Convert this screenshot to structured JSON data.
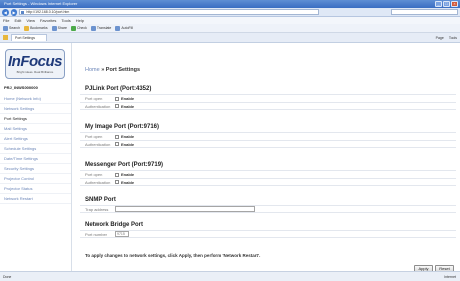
{
  "window": {
    "title": "Port Settings - Windows Internet Explorer"
  },
  "browser": {
    "url": "http://192.168.0.10/port.htm",
    "menu": [
      "File",
      "Edit",
      "View",
      "Favorites",
      "Tools",
      "Help"
    ],
    "toolbar_items": [
      "Search",
      "Bookmarks",
      "Share",
      "Check",
      "Translate",
      "AutoFill"
    ],
    "tab_title": "Port Settings",
    "tab_tools": [
      "Page",
      "Tools"
    ],
    "status_text": "Done",
    "status_right": "Internet"
  },
  "sidebar": {
    "logo": "InFocus",
    "logo_tagline": "Bright ideas. Real Brilliance",
    "device_name": "PRJ_INWS000000",
    "items": [
      {
        "label": "Home (Network Info)",
        "active": false
      },
      {
        "label": "Network Settings",
        "active": false
      },
      {
        "label": "Port Settings",
        "active": true
      },
      {
        "label": "Mail Settings",
        "active": false
      },
      {
        "label": "Alert Settings",
        "active": false
      },
      {
        "label": "Schedule Settings",
        "active": false
      },
      {
        "label": "Date/Time Settings",
        "active": false
      },
      {
        "label": "Security Settings",
        "active": false
      },
      {
        "label": "Projector Control",
        "active": false
      },
      {
        "label": "Projector Status",
        "active": false
      },
      {
        "label": "Network Restart",
        "active": false
      }
    ]
  },
  "main": {
    "breadcrumb_home": "Home",
    "breadcrumb_sep": " » ",
    "breadcrumb_current": "Port Settings",
    "pjlink": {
      "title": "PJLink Port (Port:4352)",
      "port_open_label": "Port open",
      "port_open_value": "Enable",
      "auth_label": "Authentication",
      "auth_value": "Enable"
    },
    "myimage": {
      "title": "My Image Port (Port:9716)",
      "port_open_label": "Port open",
      "port_open_value": "Enable",
      "auth_label": "Authentication",
      "auth_value": "Enable"
    },
    "messenger": {
      "title": "Messenger Port (Port:9719)",
      "port_open_label": "Port open",
      "port_open_value": "Enable",
      "auth_label": "Authentication",
      "auth_value": "Enable"
    },
    "snmp": {
      "title": "SNMP Port",
      "trap_label": "Trap address",
      "trap_value": ""
    },
    "bridge": {
      "title": "Network Bridge Port",
      "port_label": "Port number",
      "port_value": "9715"
    },
    "notice": "To apply changes to network settings, click Apply, then perform 'Network Restart'.",
    "apply_label": "Apply",
    "reset_label": "Reset"
  }
}
